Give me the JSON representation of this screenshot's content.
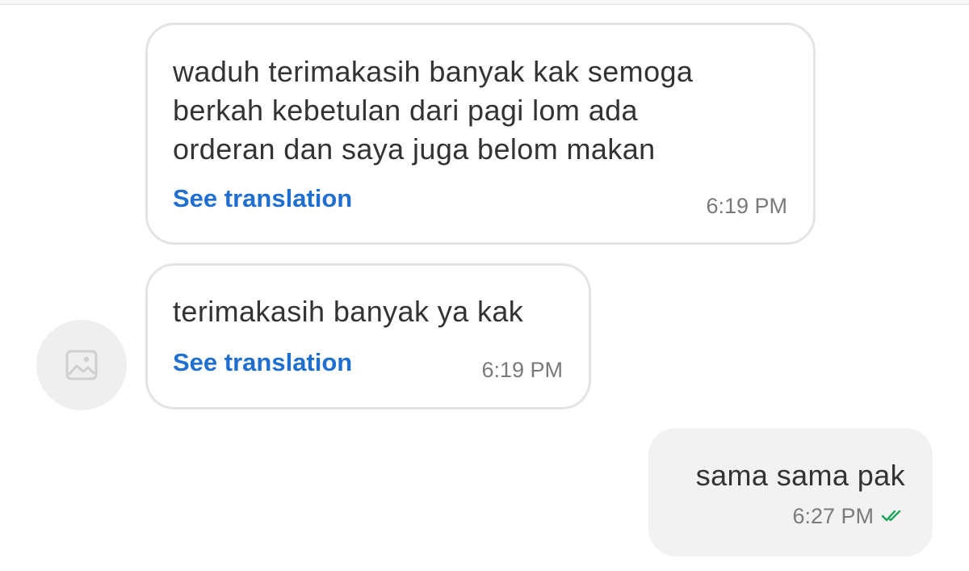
{
  "messages": [
    {
      "text": "waduh terimakasih banyak kak semoga\nberkah kebetulan dari pagi lom ada\norderan dan saya juga belom makan",
      "translate_label": "See translation",
      "time": "6:19 PM"
    },
    {
      "text": "terimakasih banyak ya kak",
      "translate_label": "See translation",
      "time": "6:19 PM"
    },
    {
      "text": "sama sama pak",
      "time": "6:27 PM",
      "status_icon": "double-check-icon",
      "status_color": "#1ea35a"
    }
  ],
  "avatar": {
    "icon": "image-placeholder-icon"
  },
  "colors": {
    "link": "#1e6fd0",
    "incoming_border": "#e4e4e4",
    "outgoing_bg": "#f2f2f2"
  }
}
